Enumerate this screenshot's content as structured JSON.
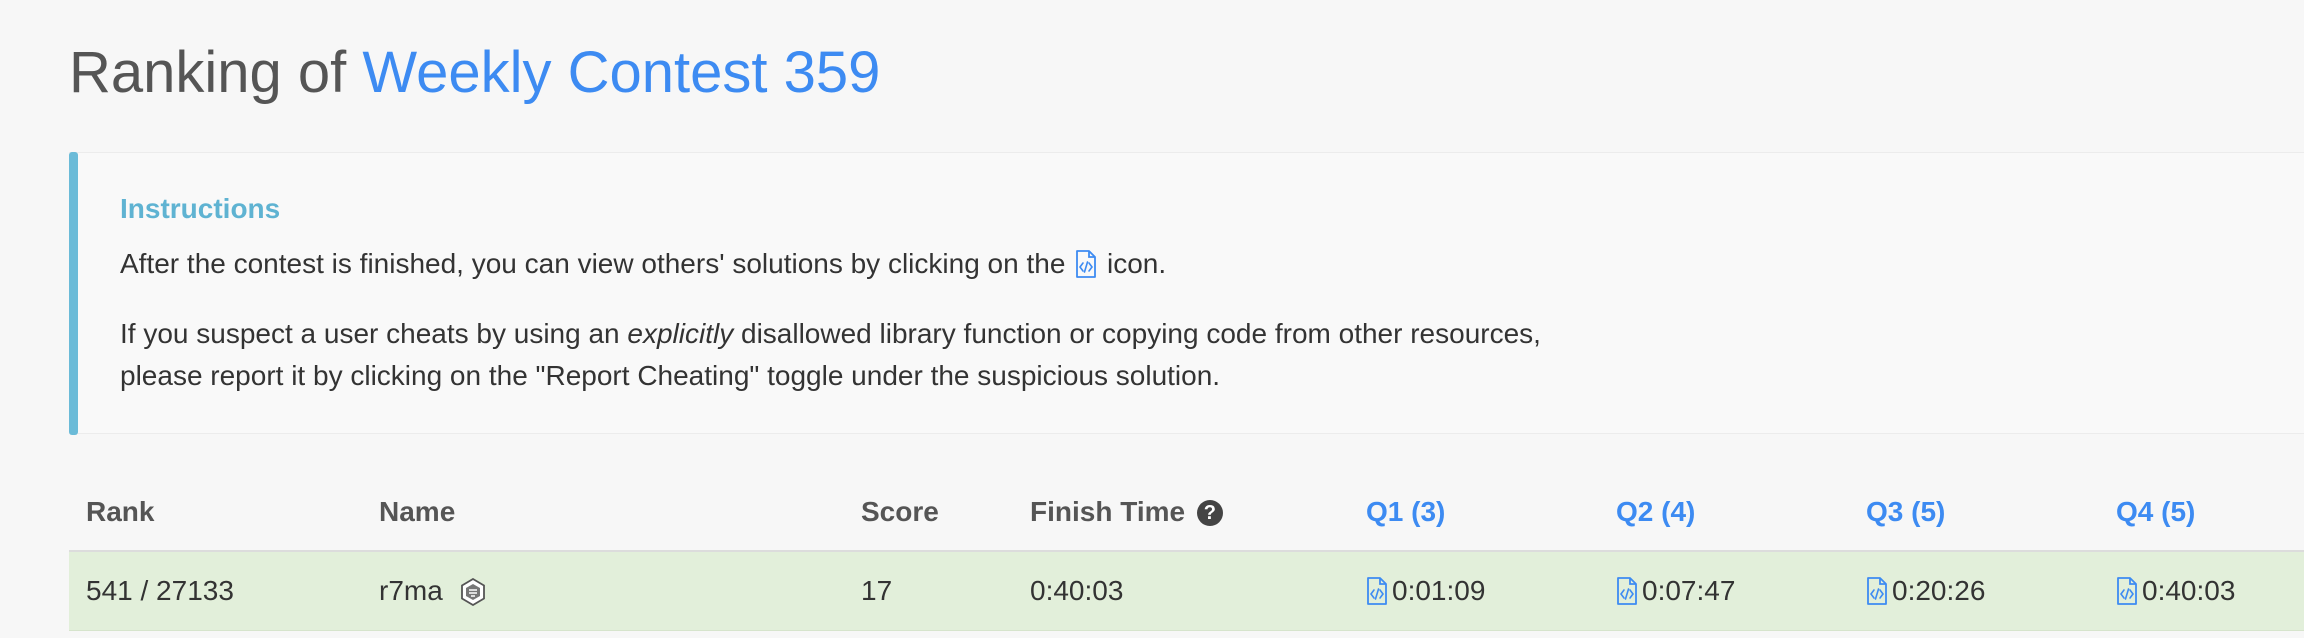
{
  "page": {
    "title_prefix": "Ranking of",
    "contest_name": "Weekly Contest 359"
  },
  "instructions": {
    "heading": "Instructions",
    "p1_before_icon": "After the contest is finished, you can view others' solutions by clicking on the",
    "p1_after_icon": "icon.",
    "p2_line1_before": "If you suspect a user cheats by using an",
    "p2_emphasis": "explicitly",
    "p2_line1_after": "disallowed library function or copying code from other resources,",
    "p2_line2": "please report it by clicking on the \"Report Cheating\" toggle under the suspicious solution."
  },
  "table": {
    "headers": {
      "rank": "Rank",
      "name": "Name",
      "score": "Score",
      "finish_time": "Finish Time",
      "q1": "Q1 (3)",
      "q2": "Q2 (4)",
      "q3": "Q3 (5)",
      "q4": "Q4 (5)"
    },
    "rows": [
      {
        "rank": "541 / 27133",
        "name": "r7ma",
        "score": "17",
        "finish_time": "0:40:03",
        "q1": "0:01:09",
        "q2": "0:07:47",
        "q3": "0:20:26",
        "q4": "0:40:03"
      }
    ]
  },
  "icons": {
    "code": "code-file-icon",
    "help": "question-circle-icon",
    "badge": "contest-badge-icon"
  },
  "colors": {
    "link": "#3d8bf2",
    "instructions_accent": "#6bbbd8",
    "row_highlight": "#e2efda"
  }
}
